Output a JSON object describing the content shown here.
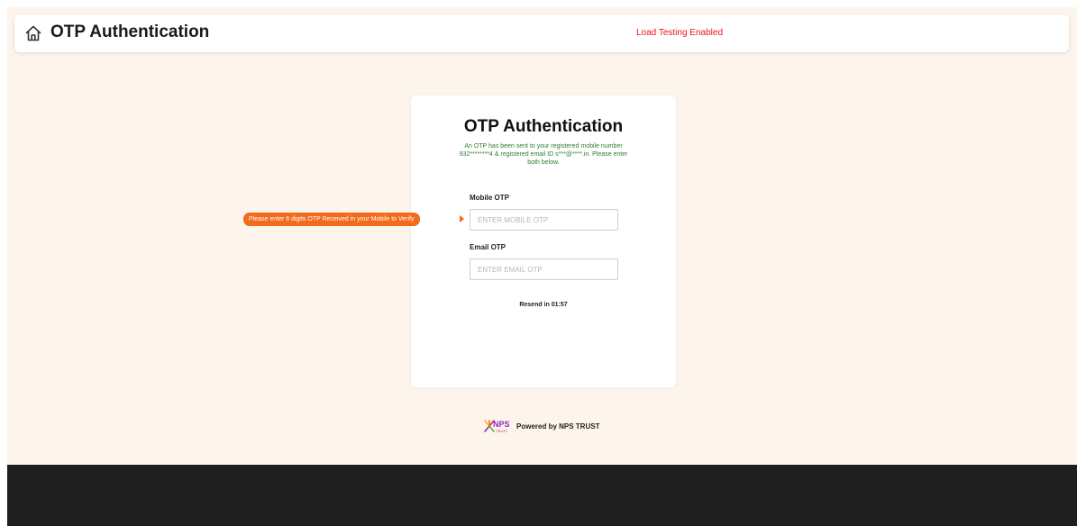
{
  "header": {
    "title": "OTP Authentication",
    "status": "Load Testing Enabled",
    "home_icon": "home-icon"
  },
  "card": {
    "title": "OTP Authentication",
    "info": "An OTP has been sent to your registered mobile number 932********4 & registered email ID s***@****.in. Please enter both below.",
    "mobile_otp": {
      "label": "Mobile OTP",
      "placeholder": "ENTER MOBILE OTP",
      "value": ""
    },
    "email_otp": {
      "label": "Email OTP",
      "placeholder": "ENTER EMAIL OTP",
      "value": ""
    },
    "resend": "Resend in 01:57"
  },
  "tooltip": {
    "text": "Please enter 6 digits OTP Received in your Mobile to Verify",
    "color": "#f26a1b"
  },
  "footer": {
    "logo_text": "NPS",
    "logo_subtext": "TRUST",
    "powered_by": "Powered by NPS TRUST"
  },
  "colors": {
    "page_background": "#fdf5ec",
    "status_red": "#e8121b",
    "info_green": "#2e7d32",
    "footer_dark": "#1f1f1f"
  }
}
